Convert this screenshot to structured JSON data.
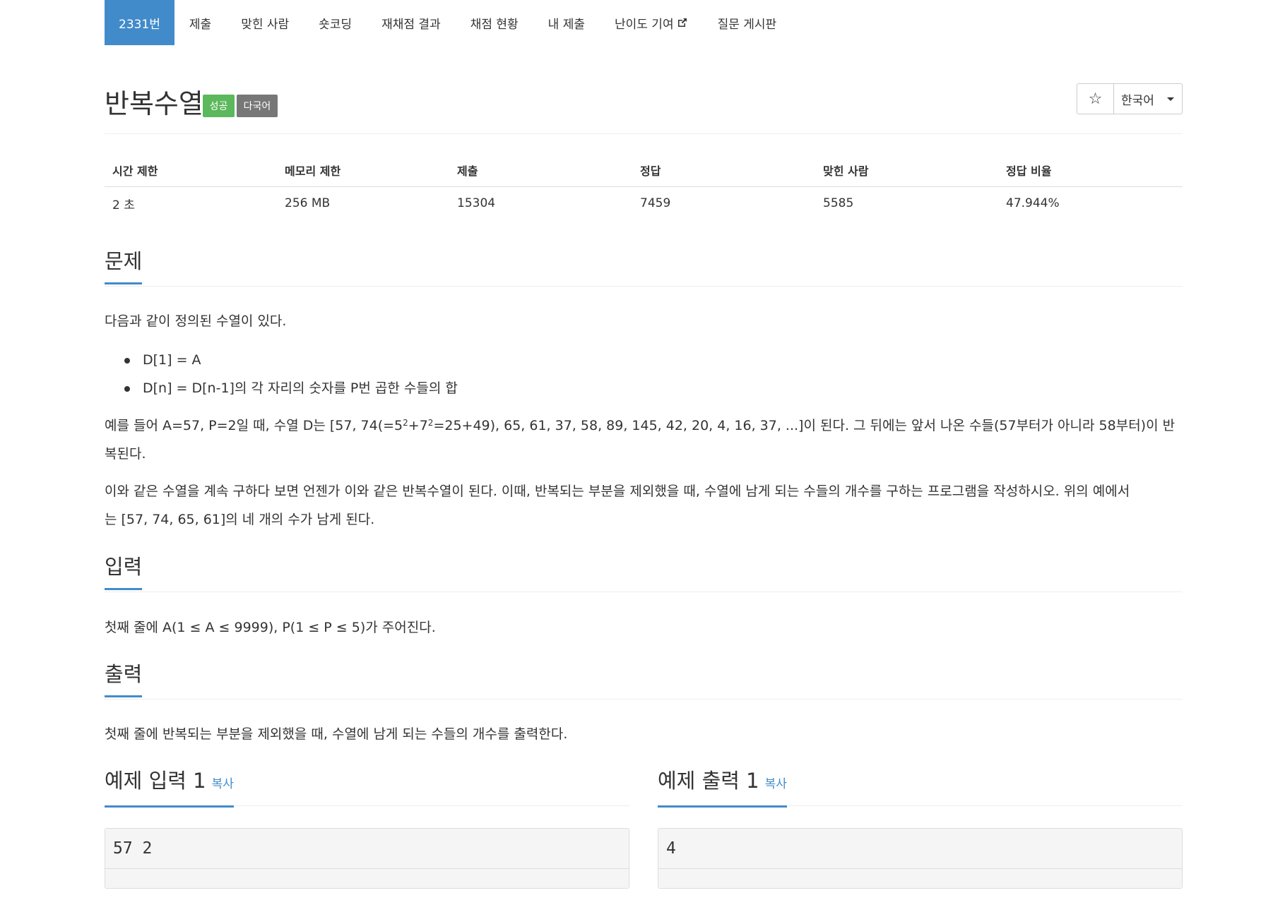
{
  "tabs": [
    {
      "label": "2331번",
      "active": true
    },
    {
      "label": "제출"
    },
    {
      "label": "맞힌 사람"
    },
    {
      "label": "숏코딩"
    },
    {
      "label": "재채점 결과"
    },
    {
      "label": "채점 현황"
    },
    {
      "label": "내 제출"
    },
    {
      "label": "난이도 기여",
      "icon": "external-link-icon"
    },
    {
      "label": "질문 게시판"
    }
  ],
  "problem": {
    "title": "반복수열",
    "badge_success": "성공",
    "badge_lang": "다국어",
    "star_icon": "☆",
    "language": "한국어"
  },
  "info": {
    "headers": [
      "시간 제한",
      "메모리 제한",
      "제출",
      "정답",
      "맞힌 사람",
      "정답 비율"
    ],
    "values": [
      "2 초",
      "256 MB",
      "15304",
      "7459",
      "5585",
      "47.944%"
    ]
  },
  "sections": {
    "description_title": "문제",
    "description_intro": "다음과 같이 정의된 수열이 있다.",
    "bullets": [
      "D[1] = A",
      "D[n] = D[n-1]의 각 자리의 숫자를 P번 곱한 수들의 합"
    ],
    "example_pre": "예를 들어 A=57, P=2일 때, 수열 D는 [57, 74(=5",
    "example_sup1": "2",
    "example_mid": "+7",
    "example_sup2": "2",
    "example_line1_rest": "=25+49), 65, 61, 37, 58, 89, 145, 42, 20, 4, 16, 37, ...]이 된다. 그 뒤에는 앞서 나온 수들(57부터가 아니라 58부터)이 반",
    "example_line2": "복된다.",
    "para2_line1": "이와 같은 수열을 계속 구하다 보면 언젠가 이와 같은 반복수열이 된다. 이때, 반복되는 부분을 제외했을 때, 수열에 남게 되는 수들의 개수를 구하는 프로그램을 작성하시오. 위의 예에서",
    "para2_line2": "는 [57, 74, 65, 61]의 네 개의 수가 남게 된다.",
    "input_title": "입력",
    "input_text": "첫째 줄에 A(1 ≤ A ≤ 9999), P(1 ≤ P ≤ 5)가 주어진다.",
    "output_title": "출력",
    "output_text": "첫째 줄에 반복되는 부분을 제외했을 때, 수열에 남게 되는 수들의 개수를 출력한다."
  },
  "samples": {
    "input_title": "예제 입력 1",
    "output_title": "예제 출력 1",
    "copy_label": "복사",
    "input_value": "57 2",
    "output_value": "4"
  }
}
